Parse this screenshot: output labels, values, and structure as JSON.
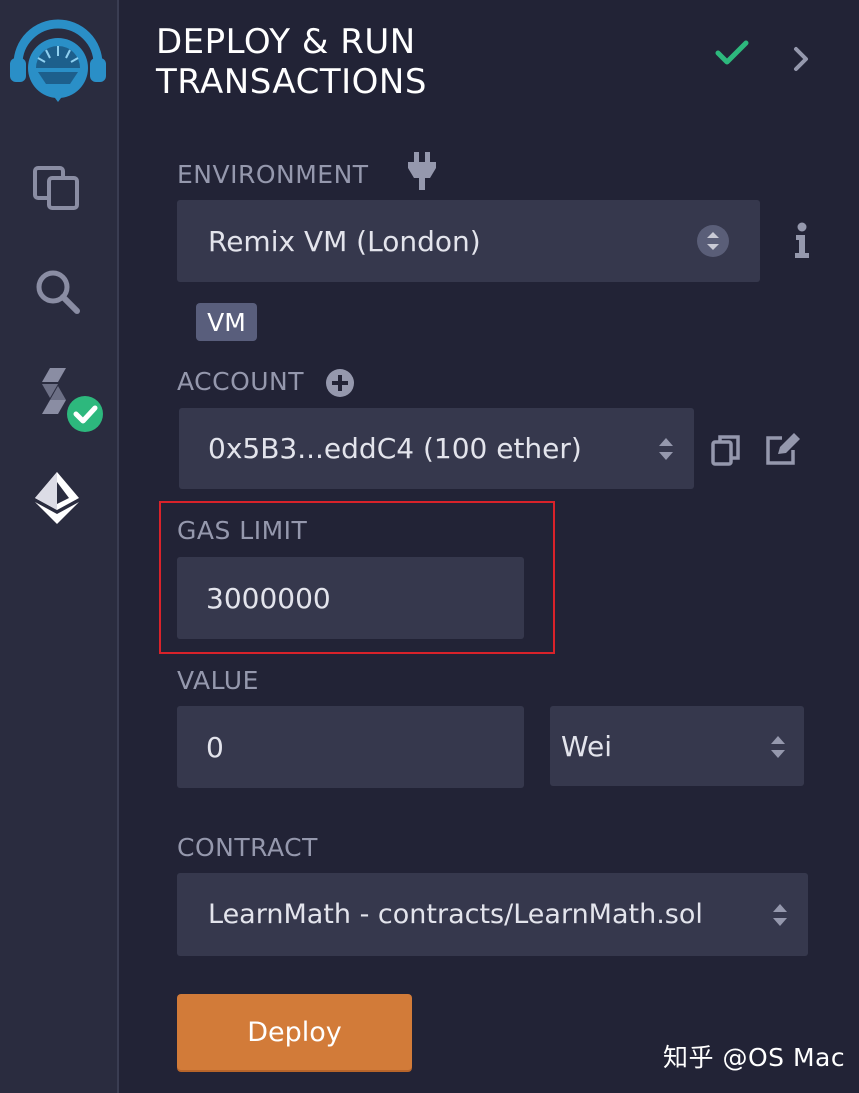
{
  "header": {
    "title_line1": "DEPLOY & RUN",
    "title_line2": "TRANSACTIONS"
  },
  "environment": {
    "label": "ENVIRONMENT",
    "value": "Remix VM (London)",
    "badge": "VM"
  },
  "account": {
    "label": "ACCOUNT",
    "value": "0x5B3...eddC4 (100 ether)"
  },
  "gas_limit": {
    "label": "GAS LIMIT",
    "value": "3000000"
  },
  "value": {
    "label": "VALUE",
    "amount": "0",
    "unit": "Wei"
  },
  "contract": {
    "label": "CONTRACT",
    "value": "LearnMath - contracts/LearnMath.sol"
  },
  "deploy_label": "Deploy",
  "watermark": "知乎 @OS Mac",
  "colors": {
    "accent_check": "#2db87d",
    "deploy": "#d27b39",
    "highlight": "#d9222a",
    "logo": "#2a8fc7"
  },
  "sidebar": {
    "icons": [
      "remix-logo-icon",
      "file-explorer-icon",
      "search-icon",
      "solidity-compiler-icon",
      "deploy-run-icon"
    ]
  }
}
